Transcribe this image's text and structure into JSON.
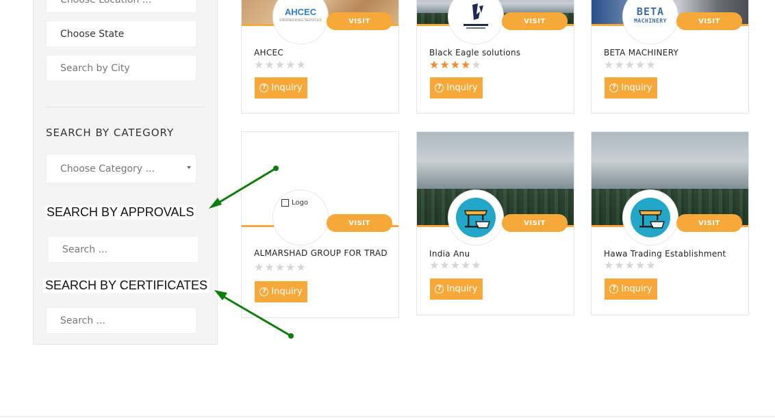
{
  "sidebar": {
    "location_placeholder": "Choose Location ...",
    "state_value": "Choose State",
    "city_placeholder": "Search by City",
    "category_heading": "SEARCH BY CATEGORY",
    "category_placeholder": "Choose Category ...",
    "approvals_heading": "SEARCH BY APPROVALS",
    "approvals_placeholder": "Search ...",
    "certificates_heading": "SEARCH BY CERTIFICATES",
    "certificates_placeholder": "Search ..."
  },
  "cards": [
    {
      "title": "AHCEC",
      "rating": 0,
      "visit": "VISIT",
      "inquiry": "Inquiry",
      "logo_text": "AHCEC",
      "logo_sub": "ENGINEERING SERVICES"
    },
    {
      "title": "Black Eagle solutions",
      "rating": 4,
      "visit": "VISIT",
      "inquiry": "Inquiry"
    },
    {
      "title": "BETA MACHINERY",
      "rating": 0,
      "visit": "VISIT",
      "inquiry": "Inquiry",
      "logo_text": "BETA",
      "logo_sub": "MACHINERY"
    },
    {
      "title": "ALMARSHAD GROUP FOR TRADING",
      "rating": 0,
      "visit": "VISIT",
      "inquiry": "Inquiry",
      "logo_alt": "Logo"
    },
    {
      "title": "India Anu",
      "rating": 0,
      "visit": "VISIT",
      "inquiry": "Inquiry"
    },
    {
      "title": "Hawa Trading Establishment",
      "rating": 0,
      "visit": "VISIT",
      "inquiry": "Inquiry"
    }
  ],
  "icons": {
    "inquiry": "question-circle-icon",
    "shop": "shop-basket-icon",
    "image": "image-icon",
    "dropdown": "caret-down-icon"
  },
  "colors": {
    "accent": "#f6a838",
    "star_on": "#f28b30",
    "star_off": "#d6d6d6",
    "arrow": "#0a7d0a",
    "shop_circle": "#22a7c9"
  }
}
